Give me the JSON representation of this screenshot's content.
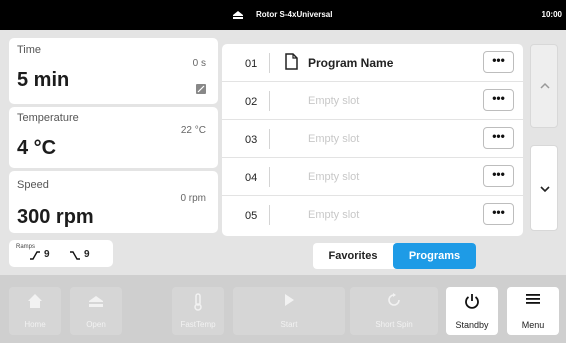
{
  "status_bar": {
    "rotor_icon": "rotor-icon",
    "rotor_name": "Rotor S-4xUniversal",
    "time": "10:00"
  },
  "parameters": {
    "time": {
      "label": "Time",
      "current": "0 s",
      "value": "5 min",
      "icon": "edit-icon"
    },
    "temperature": {
      "label": "Temperature",
      "current": "22 °C",
      "value": "4 °C"
    },
    "speed": {
      "label": "Speed",
      "current": "0 rpm",
      "value": "300 rpm"
    },
    "ramps": {
      "label": "Ramps",
      "acceleration": "9",
      "deceleration": "9"
    }
  },
  "programs": {
    "rows": [
      {
        "num": "01",
        "name": "Program Name",
        "empty": false,
        "icon": "document-icon"
      },
      {
        "num": "02",
        "name": "Empty slot",
        "empty": true
      },
      {
        "num": "03",
        "name": "Empty slot",
        "empty": true
      },
      {
        "num": "04",
        "name": "Empty slot",
        "empty": true
      },
      {
        "num": "05",
        "name": "Empty slot",
        "empty": true
      }
    ],
    "more_label": "•••",
    "scroll_up_enabled": false,
    "scroll_down_enabled": true
  },
  "tabs": {
    "favorites": "Favorites",
    "programs": "Programs",
    "active": "programs",
    "accent": "#1e9be6"
  },
  "toolbar": {
    "home": "Home",
    "open": "Open",
    "fasttemp": "FastTemp",
    "start": "Start",
    "short_spin": "Short Spin",
    "standby": "Standby",
    "menu": "Menu"
  }
}
